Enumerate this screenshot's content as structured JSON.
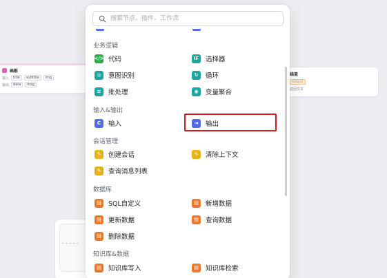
{
  "search": {
    "placeholder": "搜索节点、插件、工作流"
  },
  "sections": [
    {
      "title": "业务逻辑",
      "items": [
        {
          "label": "代码",
          "icon": "code-icon",
          "glyph": "</>",
          "color": "#2ab04f"
        },
        {
          "label": "选择器",
          "icon": "if-icon",
          "glyph": "IF",
          "color": "#1aa6a1"
        },
        {
          "label": "意图识别",
          "icon": "intent-icon",
          "glyph": "◎",
          "color": "#1aa6a1"
        },
        {
          "label": "循环",
          "icon": "loop-icon",
          "glyph": "↻",
          "color": "#1aa6a1"
        },
        {
          "label": "批处理",
          "icon": "batch-icon",
          "glyph": "≡",
          "color": "#1aa6a1"
        },
        {
          "label": "变量聚合",
          "icon": "variable-aggregate-icon",
          "glyph": "◉",
          "color": "#1aa6a1"
        }
      ]
    },
    {
      "title": "输入&输出",
      "items": [
        {
          "label": "输入",
          "icon": "input-icon",
          "glyph": "C",
          "color": "#5468e8"
        },
        {
          "label": "输出",
          "icon": "output-icon",
          "glyph": "D",
          "color": "#5468e8"
        }
      ]
    },
    {
      "title": "会话管理",
      "items": [
        {
          "label": "创建会话",
          "icon": "create-conversation-icon",
          "glyph": "✎",
          "color": "#e8b21a"
        },
        {
          "label": "清除上下文",
          "icon": "clear-context-icon",
          "glyph": "✎",
          "color": "#e8b21a"
        },
        {
          "label": "查询消息列表",
          "icon": "query-messages-icon",
          "glyph": "✎",
          "color": "#e8b21a"
        }
      ]
    },
    {
      "title": "数据库",
      "items": [
        {
          "label": "SQL自定义",
          "icon": "sql-icon",
          "glyph": "▤",
          "color": "#eb7a2e"
        },
        {
          "label": "新增数据",
          "icon": "add-data-icon",
          "glyph": "▤",
          "color": "#eb7a2e"
        },
        {
          "label": "更新数据",
          "icon": "update-data-icon",
          "glyph": "▤",
          "color": "#eb7a2e"
        },
        {
          "label": "查询数据",
          "icon": "query-data-icon",
          "glyph": "▤",
          "color": "#eb7a2e"
        },
        {
          "label": "删除数据",
          "icon": "delete-data-icon",
          "glyph": "▤",
          "color": "#eb7a2e"
        }
      ]
    },
    {
      "title": "知识库&数据",
      "items": [
        {
          "label": "知识库写入",
          "icon": "kb-write-icon",
          "glyph": "▤",
          "color": "#eb7a2e"
        },
        {
          "label": "知识库检索",
          "icon": "kb-search-icon",
          "glyph": "▤",
          "color": "#eb7a2e"
        }
      ]
    }
  ],
  "background": {
    "left_node": {
      "title": "画板",
      "row1_label": "输入",
      "row1_tags": [
        "title",
        "subtitle",
        "img"
      ],
      "row2_label": "输出",
      "row2_tags": [
        "data",
        "msg"
      ]
    },
    "right_node": {
      "title": "结束",
      "tag": "output",
      "row2": "返回文本"
    }
  },
  "colors": {
    "highlight": "#c81e24",
    "accent": "#5468e8"
  }
}
